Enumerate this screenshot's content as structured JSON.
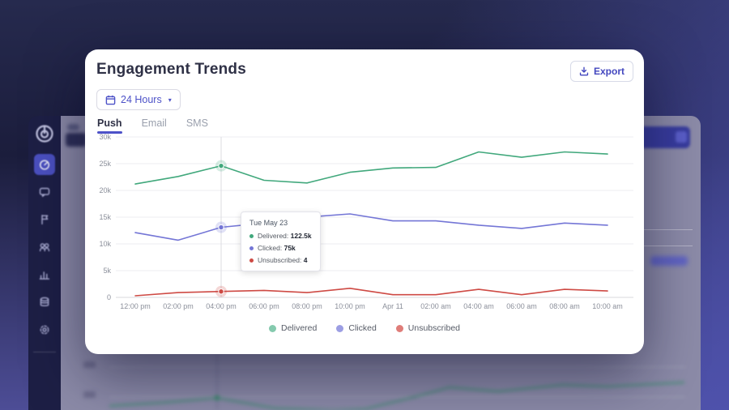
{
  "modal": {
    "title": "Engagement Trends",
    "export_label": "Export",
    "time_range_label": "24 Hours",
    "tabs": [
      {
        "label": "Push",
        "active": true
      },
      {
        "label": "Email",
        "active": false
      },
      {
        "label": "SMS",
        "active": false
      }
    ],
    "tooltip": {
      "date": "Tue May 23",
      "rows": [
        {
          "label": "Delivered",
          "value": "122.5k",
          "color": "#41a87c"
        },
        {
          "label": "Clicked",
          "value": "75k",
          "color": "#7476d6"
        },
        {
          "label": "Unsubscribed",
          "value": "4",
          "color": "#ce4a44"
        }
      ]
    },
    "legend": [
      {
        "label": "Delivered",
        "color": "#5cb893"
      },
      {
        "label": "Clicked",
        "color": "#7b7dda"
      },
      {
        "label": "Unsubscribed",
        "color": "#d4524c"
      }
    ]
  },
  "chart_data": {
    "type": "line",
    "x": [
      "12:00 pm",
      "02:00 pm",
      "04:00 pm",
      "06:00 pm",
      "08:00 pm",
      "10:00 pm",
      "Apr 11",
      "02:00 am",
      "04:00 am",
      "06:00 am",
      "08:00 am",
      "10:00 am"
    ],
    "series": [
      {
        "name": "Delivered",
        "color": "#41a87c",
        "values": [
          21200,
          22600,
          24600,
          21900,
          21400,
          23400,
          24200,
          24300,
          27200,
          26200,
          27200,
          26800
        ]
      },
      {
        "name": "Clicked",
        "color": "#7476d6",
        "values": [
          12100,
          10700,
          13100,
          13900,
          15000,
          15600,
          14300,
          14300,
          13500,
          12900,
          13900,
          13500
        ]
      },
      {
        "name": "Unsubscribed",
        "color": "#ce4a44",
        "values": [
          300,
          900,
          1100,
          1300,
          900,
          1700,
          500,
          500,
          1500,
          500,
          1500,
          1200
        ]
      }
    ],
    "ylim": [
      0,
      30000
    ],
    "yticks": [
      "0",
      "5k",
      "10k",
      "15k",
      "20k",
      "25k",
      "30k"
    ],
    "highlight_index": 2,
    "grid": true,
    "legend_position": "bottom",
    "title": "Engagement Trends",
    "xlabel": "",
    "ylabel": ""
  },
  "sidebar": {
    "items": [
      {
        "icon": "gauge-icon",
        "active": true
      },
      {
        "icon": "chat-icon",
        "active": false
      },
      {
        "icon": "journey-icon",
        "active": false
      },
      {
        "icon": "audience-icon",
        "active": false
      },
      {
        "icon": "bar-chart-icon",
        "active": false
      },
      {
        "icon": "database-icon",
        "active": false
      },
      {
        "icon": "gear-icon",
        "active": false
      }
    ]
  },
  "colors": {
    "accent": "#4d52c8",
    "sidebar_bg": "#1d1f45",
    "active_tile": "#4b50c0"
  }
}
